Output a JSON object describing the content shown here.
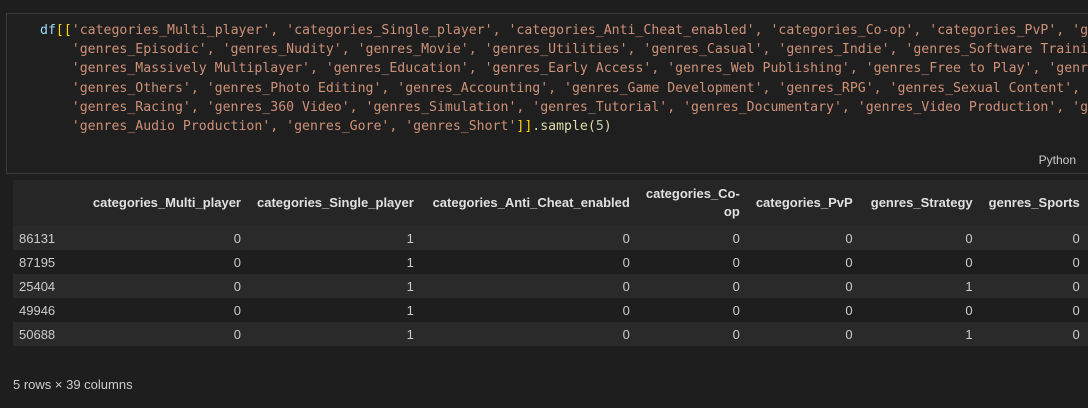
{
  "code_cell": {
    "lines": [
      {
        "prefix": "df",
        "open": "[[",
        "body": "'categories_Multi_player', 'categories_Single_player', 'categories_Anti_Cheat_enabled', 'categories_Co-op', 'categories_PvP', 'genres_Strategy', 'genres_Sports',"
      },
      {
        "indent": "    ",
        "body": "'genres_Episodic', 'genres_Nudity', 'genres_Movie', 'genres_Utilities', 'genres_Casual', 'genres_Indie', 'genres_Software Training', 'genres_Design & Illustration',"
      },
      {
        "indent": "    ",
        "body": "'genres_Massively Multiplayer', 'genres_Education', 'genres_Early Access', 'genres_Web Publishing', 'genres_Free to Play', 'genres_Animation & Modeling',"
      },
      {
        "indent": "    ",
        "body": "'genres_Others', 'genres_Photo Editing', 'genres_Accounting', 'genres_Game Development', 'genres_RPG', 'genres_Sexual Content', 'genres_Violent',"
      },
      {
        "indent": "    ",
        "body": "'genres_Racing', 'genres_360 Video', 'genres_Simulation', 'genres_Tutorial', 'genres_Documentary', 'genres_Video Production', 'genres_Adventure',"
      },
      {
        "indent": "    ",
        "body": "'genres_Audio Production', 'genres_Gore', 'genres_Short'",
        "close": "]]",
        "method": ".sample(",
        "arg": "5",
        "end": ")"
      }
    ],
    "language_label": "Python"
  },
  "table": {
    "columns": [
      "categories_Multi_player",
      "categories_Single_player",
      "categories_Anti_Cheat_enabled",
      "categories_Co-op",
      "categories_PvP",
      "genres_Strategy",
      "genres_Sports"
    ],
    "rows": [
      {
        "index": "86131",
        "values": [
          "0",
          "1",
          "0",
          "0",
          "0",
          "0",
          "0"
        ]
      },
      {
        "index": "87195",
        "values": [
          "0",
          "1",
          "0",
          "0",
          "0",
          "0",
          "0"
        ]
      },
      {
        "index": "25404",
        "values": [
          "0",
          "1",
          "0",
          "0",
          "0",
          "1",
          "0"
        ]
      },
      {
        "index": "49946",
        "values": [
          "0",
          "1",
          "0",
          "0",
          "0",
          "0",
          "0"
        ]
      },
      {
        "index": "50688",
        "values": [
          "0",
          "1",
          "0",
          "0",
          "0",
          "1",
          "0"
        ]
      }
    ]
  },
  "footer_text": "5 rows × 39 columns"
}
